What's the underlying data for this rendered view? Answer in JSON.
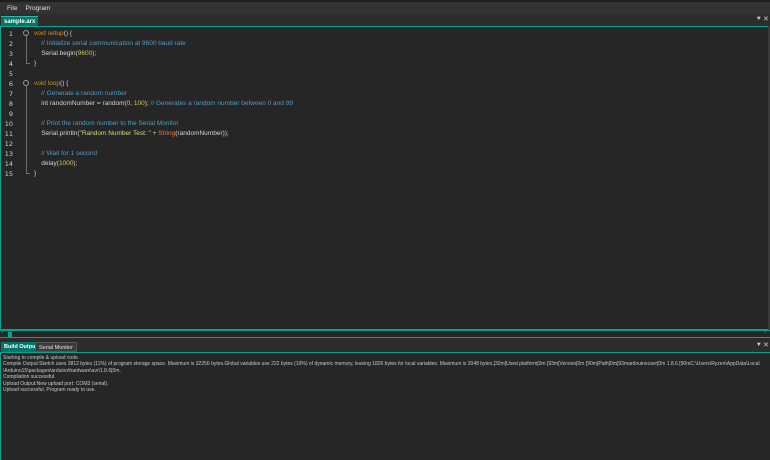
{
  "menu": [
    "File",
    "Program"
  ],
  "editor": {
    "tab_label": "sample.arx",
    "pin_icon": "pin-icon",
    "close_icon": "close-icon",
    "lines": [
      {
        "num": "1",
        "tokens": [
          {
            "t": "void",
            "c": "kw"
          },
          {
            "t": " "
          },
          {
            "t": "setup",
            "c": "fn"
          },
          {
            "t": "() {"
          }
        ]
      },
      {
        "num": "2",
        "tokens": [
          {
            "t": "    "
          },
          {
            "t": "// Initialize serial communication at 9600 baud rate",
            "c": "cm"
          }
        ]
      },
      {
        "num": "3",
        "tokens": [
          {
            "t": "    Serial.begin("
          },
          {
            "t": "9600",
            "c": "num"
          },
          {
            "t": ");"
          }
        ]
      },
      {
        "num": "4",
        "tokens": [
          {
            "t": "}"
          }
        ]
      },
      {
        "num": "5",
        "tokens": []
      },
      {
        "num": "6",
        "tokens": [
          {
            "t": "void",
            "c": "kw"
          },
          {
            "t": " "
          },
          {
            "t": "loop",
            "c": "fn"
          },
          {
            "t": "() {"
          }
        ]
      },
      {
        "num": "7",
        "tokens": [
          {
            "t": "    "
          },
          {
            "t": "// Generate a random number",
            "c": "cm"
          }
        ]
      },
      {
        "num": "8",
        "tokens": [
          {
            "t": "    int randomNumber = random("
          },
          {
            "t": "0",
            "c": "num"
          },
          {
            "t": ", "
          },
          {
            "t": "100",
            "c": "num"
          },
          {
            "t": "); "
          },
          {
            "t": "// Generates a random number between 0 and 99",
            "c": "cm"
          }
        ]
      },
      {
        "num": "9",
        "tokens": []
      },
      {
        "num": "10",
        "tokens": [
          {
            "t": "    "
          },
          {
            "t": "// Print the random number to the Serial Monitor",
            "c": "cm"
          }
        ]
      },
      {
        "num": "11",
        "tokens": [
          {
            "t": "    Serial.println("
          },
          {
            "t": "\"Random Number Test: \"",
            "c": "str"
          },
          {
            "t": " + "
          },
          {
            "t": "String",
            "c": "ty"
          },
          {
            "t": "(randomNumber));"
          }
        ]
      },
      {
        "num": "12",
        "tokens": []
      },
      {
        "num": "13",
        "tokens": [
          {
            "t": "    "
          },
          {
            "t": "// Wait for 1 second",
            "c": "cm"
          }
        ]
      },
      {
        "num": "14",
        "tokens": [
          {
            "t": "    delay("
          },
          {
            "t": "1000",
            "c": "num"
          },
          {
            "t": ");"
          }
        ]
      },
      {
        "num": "15",
        "tokens": [
          {
            "t": "}"
          }
        ]
      }
    ]
  },
  "output_panel": {
    "tabs": [
      "Build Output",
      "Serial Monitor"
    ],
    "active_tab": "Build Output",
    "lines": [
      "Starting to compile & upload code.",
      "Compile Output:Sketch uses 3812 bytes (11%) of program storage space. Maximum is 32256 bytes.Global variables use 222 bytes (10%) of dynamic memory, leaving 1826 bytes for local variables. Maximum is 2048 bytes.[32m[Used platform[0m [93m[Version[0m [90m[Path[0m[93mardouinocavr[0m   1.8.6   [90mC:\\Users\\Ryzen\\AppData\\Local",
      "\\Arduino15\\packages\\arduino\\hardware\\avr\\1.8.6[0m.",
      "Compilation successful.",
      "Upload Output:New upload port: COM3 (serial).",
      "Upload successful. Program ready to use."
    ]
  },
  "colors": {
    "accent": "#00a693",
    "tab_active": "#00766a",
    "background": "#262626"
  }
}
